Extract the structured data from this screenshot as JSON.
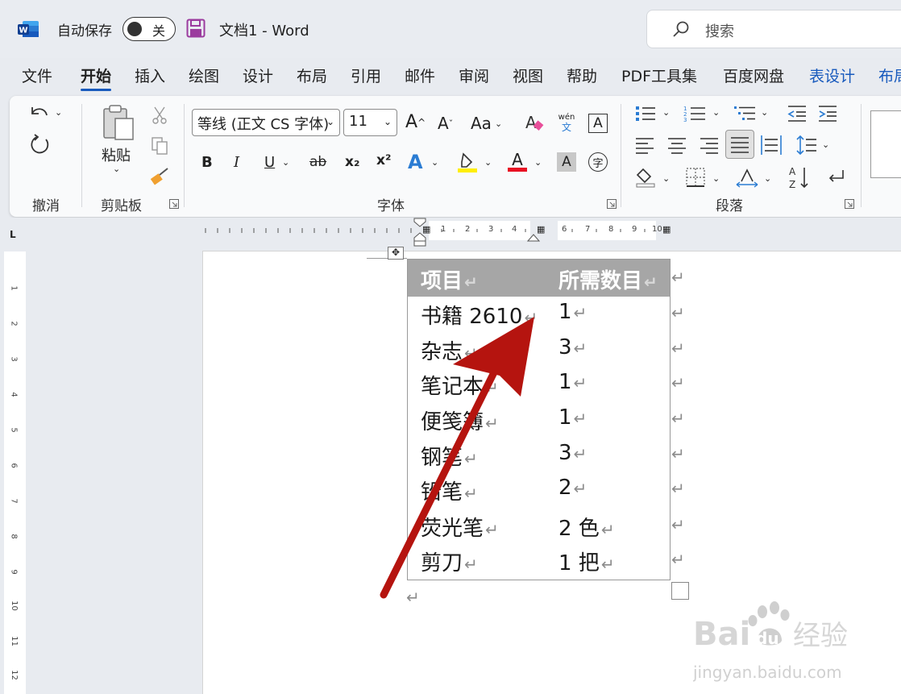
{
  "titlebar": {
    "app_icon": "word-logo-icon",
    "autosave_label": "自动保存",
    "autosave_state": "关",
    "doc_title": "文档1  -  Word",
    "search_placeholder": "搜索"
  },
  "tabs": [
    {
      "label": "文件"
    },
    {
      "label": "开始",
      "active": true
    },
    {
      "label": "插入"
    },
    {
      "label": "绘图"
    },
    {
      "label": "设计"
    },
    {
      "label": "布局"
    },
    {
      "label": "引用"
    },
    {
      "label": "邮件"
    },
    {
      "label": "审阅"
    },
    {
      "label": "视图"
    },
    {
      "label": "帮助"
    },
    {
      "label": "PDF工具集"
    },
    {
      "label": "百度网盘"
    },
    {
      "label": "表设计",
      "context": true
    },
    {
      "label": "布局",
      "context": true
    }
  ],
  "ribbon": {
    "groups": {
      "undo": "撤消",
      "clipboard": "剪贴板",
      "font": "字体",
      "paragraph": "段落"
    },
    "paste_label": "粘贴",
    "font_name": "等线 (正文 CS 字体)",
    "font_size": "11",
    "change_case": "Aa",
    "phonetic_top": "wén",
    "phonetic_bottom": "文",
    "bold": "B",
    "italic": "I",
    "underline": "U",
    "strike": "ab",
    "subscript": "x₂",
    "superscript": "x²",
    "text_effect": "A",
    "font_color": "A",
    "char_shading": "A",
    "enclose_char": "字",
    "char_border": "A"
  },
  "ruler": {
    "numbers": [
      "1",
      "2",
      "3",
      "4",
      "6",
      "7",
      "8",
      "9",
      "10"
    ],
    "vnumbers": [
      "1",
      "2",
      "3",
      "4",
      "5",
      "6",
      "7",
      "8",
      "9",
      "10",
      "11",
      "12"
    ]
  },
  "table": {
    "header": [
      "项目",
      "所需数目"
    ],
    "rows": [
      [
        "书籍  2610",
        "1"
      ],
      [
        "杂志",
        "3"
      ],
      [
        "笔记本",
        "1"
      ],
      [
        "便笺簿",
        "1"
      ],
      [
        "钢笔",
        "3"
      ],
      [
        "铅笔",
        "2"
      ],
      [
        "荧光笔",
        "2  色"
      ],
      [
        "剪刀",
        "1  把"
      ]
    ],
    "para_mark": "↵"
  },
  "watermark": {
    "brand_text": "Bai",
    "brand_text2": "du",
    "brand_cn": "经验",
    "url": "jingyan.baidu.com"
  },
  "colors": {
    "accent": "#185abd",
    "header_fill": "#a6a6a6",
    "arrow": "#b5140f",
    "highlight": "#ffee00",
    "font_red": "#e81123"
  }
}
